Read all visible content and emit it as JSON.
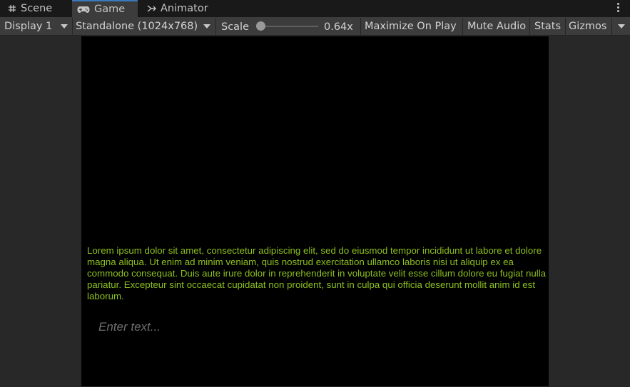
{
  "tabs": [
    {
      "label": "Scene",
      "icon": "grid-icon"
    },
    {
      "label": "Game",
      "icon": "gamepad-icon",
      "active": true
    },
    {
      "label": "Animator",
      "icon": "animator-icon"
    }
  ],
  "toolbar": {
    "display": "Display 1",
    "resolution": "Standalone (1024x768)",
    "scale_label": "Scale",
    "scale_value": "0.64x",
    "maximize": "Maximize On Play",
    "mute": "Mute Audio",
    "stats": "Stats",
    "gizmos": "Gizmos"
  },
  "game": {
    "lorem": "Lorem ipsum dolor sit amet, consectetur adipiscing elit, sed do eiusmod tempor incididunt ut labore et dolore magna aliqua. Ut enim ad minim veniam, quis nostrud exercitation ullamco laboris nisi ut aliquip ex ea commodo consequat. Duis aute irure dolor in reprehenderit in voluptate velit esse cillum dolore eu fugiat nulla pariatur. Excepteur sint occaecat cupidatat non proident, sunt in culpa qui officia deserunt mollit anim id est laborum.",
    "input_placeholder": "Enter text...",
    "input_value": ""
  },
  "colors": {
    "accent": "#3a79bb",
    "lorem_text": "#8dc01e",
    "panel": "#3c3c3c",
    "background": "#282828"
  }
}
